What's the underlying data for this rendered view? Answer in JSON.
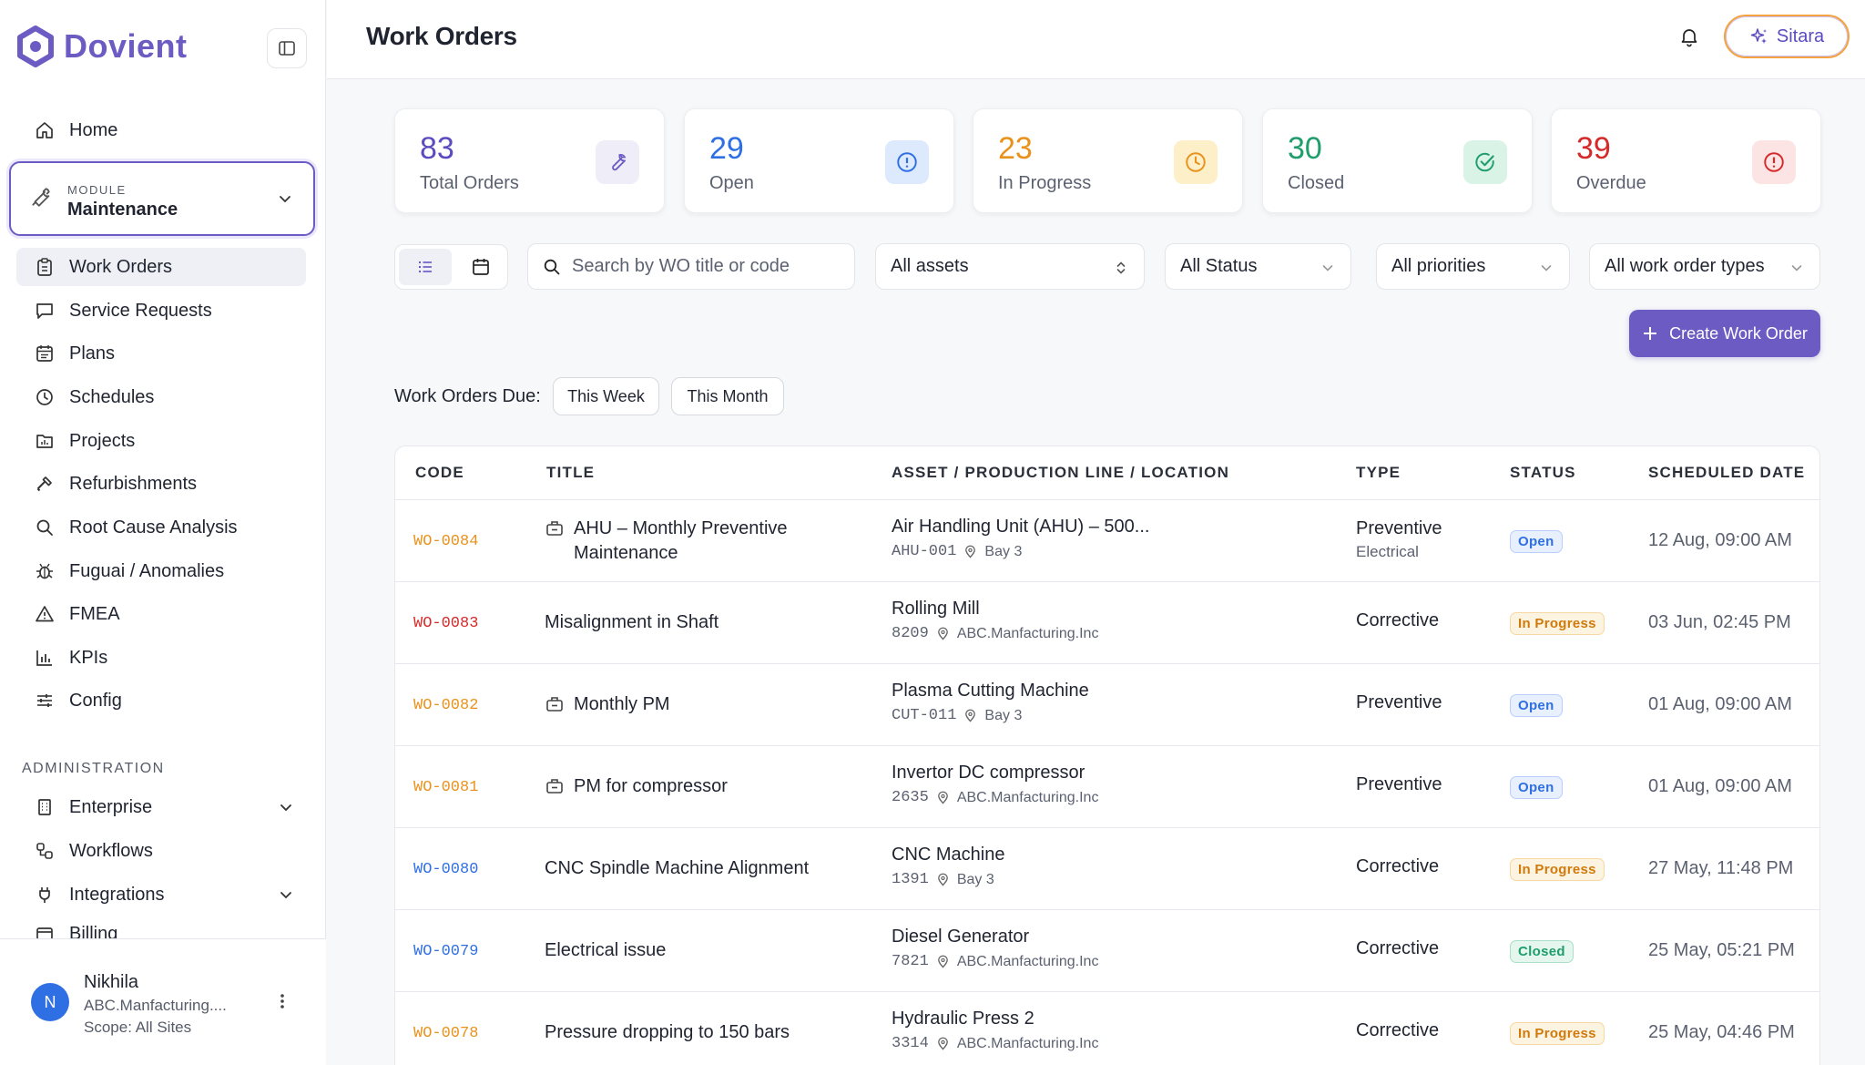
{
  "brand": {
    "name": "Dovient"
  },
  "sidebar": {
    "home": "Home",
    "module": {
      "label": "MODULE",
      "value": "Maintenance"
    },
    "items": [
      {
        "label": "Work Orders",
        "icon": "clipboard-icon",
        "active": true
      },
      {
        "label": "Service Requests",
        "icon": "message-icon"
      },
      {
        "label": "Plans",
        "icon": "calendar-list-icon"
      },
      {
        "label": "Schedules",
        "icon": "clock-icon"
      },
      {
        "label": "Projects",
        "icon": "folder-chart-icon"
      },
      {
        "label": "Refurbishments",
        "icon": "hammer-icon"
      },
      {
        "label": "Root Cause Analysis",
        "icon": "search-icon"
      },
      {
        "label": "Fuguai / Anomalies",
        "icon": "bug-icon"
      },
      {
        "label": "FMEA",
        "icon": "warning-icon"
      },
      {
        "label": "KPIs",
        "icon": "bar-chart-icon"
      },
      {
        "label": "Config",
        "icon": "sliders-icon"
      }
    ],
    "admin_label": "ADMINISTRATION",
    "admin_items": [
      {
        "label": "Enterprise",
        "icon": "building-icon",
        "expandable": true
      },
      {
        "label": "Workflows",
        "icon": "workflow-icon"
      },
      {
        "label": "Integrations",
        "icon": "plug-icon",
        "expandable": true
      },
      {
        "label": "Billing",
        "icon": "card-icon"
      }
    ],
    "user": {
      "initial": "N",
      "name": "Nikhila",
      "org": "ABC.Manfacturing....",
      "scope": "Scope: All Sites"
    }
  },
  "header": {
    "title": "Work Orders",
    "assistant": "Sitara"
  },
  "stats": [
    {
      "value": "83",
      "label": "Total Orders",
      "color": "#5b4bc0",
      "icon": "wrench-icon"
    },
    {
      "value": "29",
      "label": "Open",
      "color": "#2f6fe4",
      "icon": "info-circle-icon"
    },
    {
      "value": "23",
      "label": "In Progress",
      "color": "#e8921c",
      "icon": "clock-icon"
    },
    {
      "value": "30",
      "label": "Closed",
      "color": "#1f9d6b",
      "icon": "check-circle-icon"
    },
    {
      "value": "39",
      "label": "Overdue",
      "color": "#d42a2a",
      "icon": "alert-circle-icon"
    }
  ],
  "filters": {
    "search_placeholder": "Search by WO title or code",
    "assets": "All assets",
    "status": "All Status",
    "priorities": "All priorities",
    "types": "All work order types"
  },
  "create_button": "Create Work Order",
  "due": {
    "label": "Work Orders Due:",
    "this_week": "This Week",
    "this_month": "This Month"
  },
  "table": {
    "columns": [
      "CODE",
      "TITLE",
      "ASSET / PRODUCTION LINE / LOCATION",
      "TYPE",
      "STATUS",
      "SCHEDULED DATE"
    ],
    "rows": [
      {
        "code": "WO-0084",
        "code_color": "#e8921c",
        "pm": true,
        "title": "AHU – Monthly Preventive Maintenance",
        "asset": "Air Handling Unit (AHU) – 500...",
        "asset_code": "AHU-001",
        "location": "Bay 3",
        "type": "Preventive",
        "type_sub": "Electrical",
        "status": "Open",
        "date": "12 Aug, 09:00 AM"
      },
      {
        "code": "WO-0083",
        "code_color": "#d42a2a",
        "pm": false,
        "title": "Misalignment in Shaft",
        "asset": "Rolling Mill",
        "asset_code": "8209",
        "location": "ABC.Manfacturing.Inc",
        "type": "Corrective",
        "type_sub": "",
        "status": "In Progress",
        "date": "03 Jun, 02:45 PM"
      },
      {
        "code": "WO-0082",
        "code_color": "#e8921c",
        "pm": true,
        "title": "Monthly PM",
        "asset": "Plasma Cutting Machine",
        "asset_code": "CUT-011",
        "location": "Bay 3",
        "type": "Preventive",
        "type_sub": "",
        "status": "Open",
        "date": "01 Aug, 09:00 AM"
      },
      {
        "code": "WO-0081",
        "code_color": "#e8921c",
        "pm": true,
        "title": "PM for compressor",
        "asset": "Invertor DC compressor",
        "asset_code": "2635",
        "location": "ABC.Manfacturing.Inc",
        "type": "Preventive",
        "type_sub": "",
        "status": "Open",
        "date": "01 Aug, 09:00 AM"
      },
      {
        "code": "WO-0080",
        "code_color": "#2f6fe4",
        "pm": false,
        "title": "CNC Spindle Machine Alignment",
        "asset": "CNC Machine",
        "asset_code": "1391",
        "location": "Bay 3",
        "type": "Corrective",
        "type_sub": "",
        "status": "In Progress",
        "date": "27 May, 11:48 PM"
      },
      {
        "code": "WO-0079",
        "code_color": "#2f6fe4",
        "pm": false,
        "title": "Electrical issue",
        "asset": "Diesel Generator",
        "asset_code": "7821",
        "location": "ABC.Manfacturing.Inc",
        "type": "Corrective",
        "type_sub": "",
        "status": "Closed",
        "date": "25 May, 05:21 PM"
      },
      {
        "code": "WO-0078",
        "code_color": "#e8921c",
        "pm": false,
        "title": "Pressure dropping to 150 bars",
        "asset": "Hydraulic Press 2",
        "asset_code": "3314",
        "location": "ABC.Manfacturing.Inc",
        "type": "Corrective",
        "type_sub": "",
        "status": "In Progress",
        "date": "25 May, 04:46 PM"
      }
    ]
  },
  "status_styles": {
    "Open": {
      "fg": "#2f6fe4",
      "bg": "#e8f0fd",
      "border": "#b9cffa"
    },
    "In Progress": {
      "fg": "#d07a0c",
      "bg": "#fdf3e1",
      "border": "#f6d8a2"
    },
    "Closed": {
      "fg": "#1f9d6b",
      "bg": "#e4f6ee",
      "border": "#a9e0c7"
    }
  }
}
